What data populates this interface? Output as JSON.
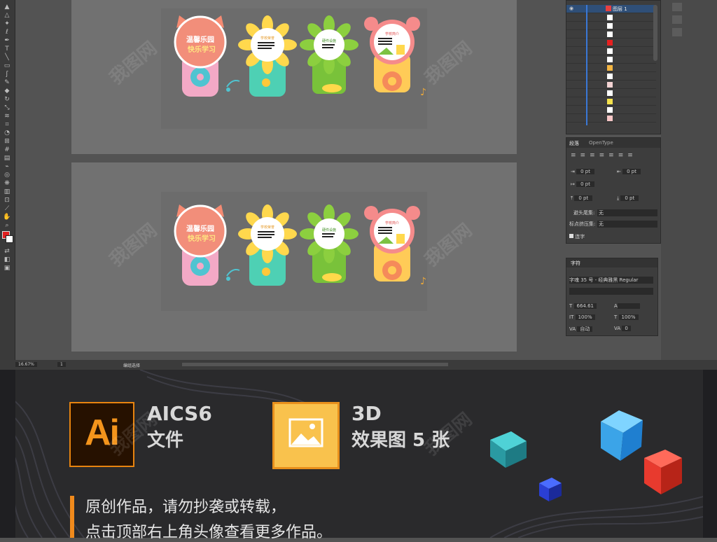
{
  "colors": {
    "accent": "#f3941c",
    "canvas": "#535353",
    "artboard": "#717171",
    "panel": "#3d3d3d",
    "bottom_bg": "#2a2a2c",
    "selection_blue": "#3a78d6"
  },
  "icons": {
    "tools": [
      "selection-tool",
      "direct-selection-tool",
      "magic-wand-tool",
      "lasso-tool",
      "pen-tool",
      "type-tool",
      "line-tool",
      "rectangle-tool",
      "paintbrush-tool",
      "pencil-tool",
      "eraser-tool",
      "rotate-tool",
      "scale-tool",
      "width-tool",
      "free-transform-tool",
      "shape-builder-tool",
      "perspective-grid-tool",
      "mesh-tool",
      "gradient-tool",
      "eyedropper-tool",
      "blend-tool",
      "symbol-sprayer-tool",
      "column-graph-tool",
      "artboard-tool",
      "slice-tool",
      "hand-tool",
      "zoom-tool"
    ]
  },
  "layers_panel": {
    "top_layer_name": "图层 1"
  },
  "paragraph_panel": {
    "tabs": [
      "段落",
      "OpenType"
    ],
    "indent_left": "0 pt",
    "indent_right": "0 pt",
    "first_line_indent": "0 pt",
    "space_before": "0 pt",
    "space_after": "0 pt",
    "kinsoku_label": "避头尾集:",
    "kinsoku_value": "无",
    "mojikumi_label": "标点挤压集:",
    "mojikumi_value": "无",
    "hyphenate_label": "连字"
  },
  "character_panel": {
    "title": "字符",
    "font_name": "字魂 35 号 - 经典雅黑 Regular",
    "font_size": "664.61",
    "leading": "",
    "horizontal_scale": "100%",
    "vertical_scale": "100%",
    "tracking": "0",
    "kerning": "自动"
  },
  "status_bar": {
    "zoom": "16.67%",
    "page": "1",
    "tool_name": "编组选择"
  },
  "artwork": {
    "sign1_line1": "温馨乐园",
    "sign1_line2": "快乐学习",
    "sign2_title": "学校荣誉",
    "sign3_title": "硬件设施",
    "sign4_title": "学校简介"
  },
  "promo": {
    "ai_icon_text": "Ai",
    "ai_title": "AICS6",
    "ai_subtitle": "文件",
    "render_title": "3D",
    "render_subtitle": "效果图 5 张",
    "note_line1": "原创作品，请勿抄袭或转载，",
    "note_line2": "点击顶部右上角头像查看更多作品。"
  },
  "watermark": "我图网"
}
